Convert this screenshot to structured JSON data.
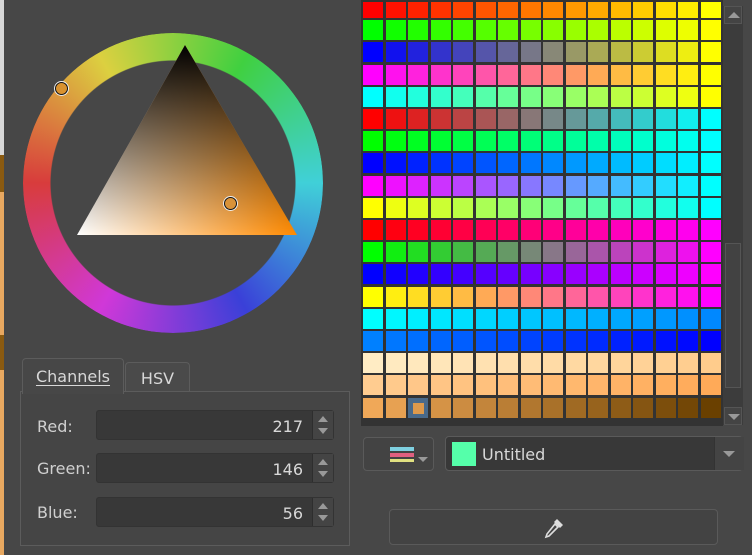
{
  "wheel": {
    "hue_colors": [
      "#d83c3c",
      "#dcd040",
      "#40d040",
      "#40d0d8",
      "#3a40d8",
      "#d038d8"
    ],
    "triangle_hue_color": "#ff8a00"
  },
  "tabs": [
    {
      "label": "Channels",
      "active": true
    },
    {
      "label": "HSV",
      "active": false
    }
  ],
  "channels": [
    {
      "label": "Red:",
      "value": "217"
    },
    {
      "label": "Green:",
      "value": "146"
    },
    {
      "label": "Blue:",
      "value": "56"
    }
  ],
  "palette": {
    "columns": 16,
    "rows": [
      [
        "#ff0000",
        "#ffff00"
      ],
      [
        "#00ff00",
        "#ffff00"
      ],
      [
        "#0000ff",
        "#ffff00"
      ],
      [
        "#ff00ff",
        "#ffff00"
      ],
      [
        "#00ffff",
        "#ffff00"
      ],
      [
        "#ff0000",
        "#00ffff"
      ],
      [
        "#00ff00",
        "#00ffff"
      ],
      [
        "#0000ff",
        "#00ffff"
      ],
      [
        "#ff00ff",
        "#00ffff"
      ],
      [
        "#ffff00",
        "#00ffff"
      ],
      [
        "#ff0000",
        "#ff00ff"
      ],
      [
        "#00ff00",
        "#ff00ff"
      ],
      [
        "#0000ff",
        "#ff00ff"
      ],
      [
        "#ffff00",
        "#ff00ff"
      ],
      [
        "#00ffff",
        "#0088ff"
      ],
      [
        "#0080ff",
        "#0000ff"
      ],
      [
        "#ffecc4",
        "#ffcc8c"
      ],
      [
        "#ffcc90",
        "#ffaa58"
      ],
      [
        "#f0a858",
        "#6a4000"
      ]
    ],
    "selected": {
      "row": 18,
      "col": 2
    },
    "selected_color": "#d99238"
  },
  "palette_select": {
    "name": "Untitled",
    "swatch": "#55ffaa"
  },
  "icons": {
    "view": "palette-view-icon",
    "eyedropper": "eyedropper-icon"
  }
}
